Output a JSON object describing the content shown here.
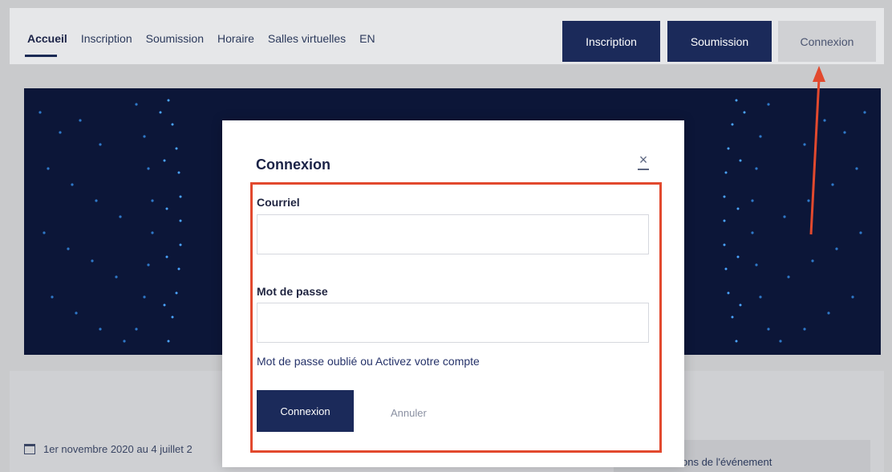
{
  "nav": {
    "links": [
      "Accueil",
      "Inscription",
      "Soumission",
      "Horaire",
      "Salles virtuelles",
      "EN"
    ],
    "active_index": 0,
    "buttons": {
      "inscription": "Inscription",
      "soumission": "Soumission",
      "connexion": "Connexion"
    }
  },
  "page": {
    "date_text": "1er novembre 2020 au 4 juillet 2",
    "side_card_text": "ons de l'événement"
  },
  "modal": {
    "title": "Connexion",
    "email_label": "Courriel",
    "email_value": "",
    "password_label": "Mot de passe",
    "password_value": "",
    "forgot_link": "Mot de passe oublié ou Activez votre compte",
    "submit_label": "Connexion",
    "cancel_label": "Annuler"
  },
  "colors": {
    "primary": "#1b2a5a",
    "highlight_box": "#e2492e",
    "arrow": "#e2492e",
    "banner": "#0c1638"
  },
  "icons": {
    "close": "close-icon",
    "calendar": "calendar-icon"
  }
}
